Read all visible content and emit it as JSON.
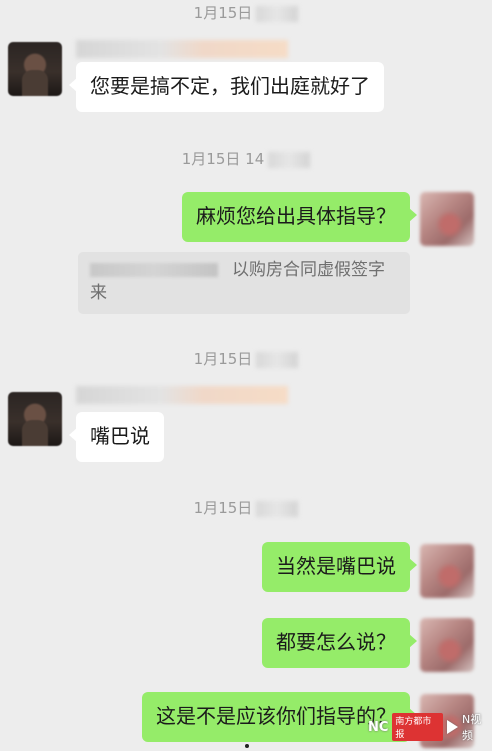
{
  "timestamps": [
    "1月15日",
    "1月15日 14",
    "1月15日",
    "1月15日"
  ],
  "messages": [
    {
      "side": "left",
      "text": "您要是搞不定，我们出庭就好了"
    },
    {
      "side": "right",
      "text": "麻烦您给出具体指导？"
    },
    {
      "side": "quote",
      "text": "以购房合同虚假签字来"
    },
    {
      "side": "left",
      "text": "嘴巴说"
    },
    {
      "side": "right",
      "text": "当然是嘴巴说"
    },
    {
      "side": "right",
      "text": "都要怎么说？"
    },
    {
      "side": "right",
      "text": "这是不是应该你们指导的？"
    }
  ],
  "quote": {
    "line1": "以购房合同虚假签字",
    "line2": "来"
  },
  "watermark": {
    "logo": "NC",
    "badge": "南方都市报",
    "brand": "N视频"
  }
}
